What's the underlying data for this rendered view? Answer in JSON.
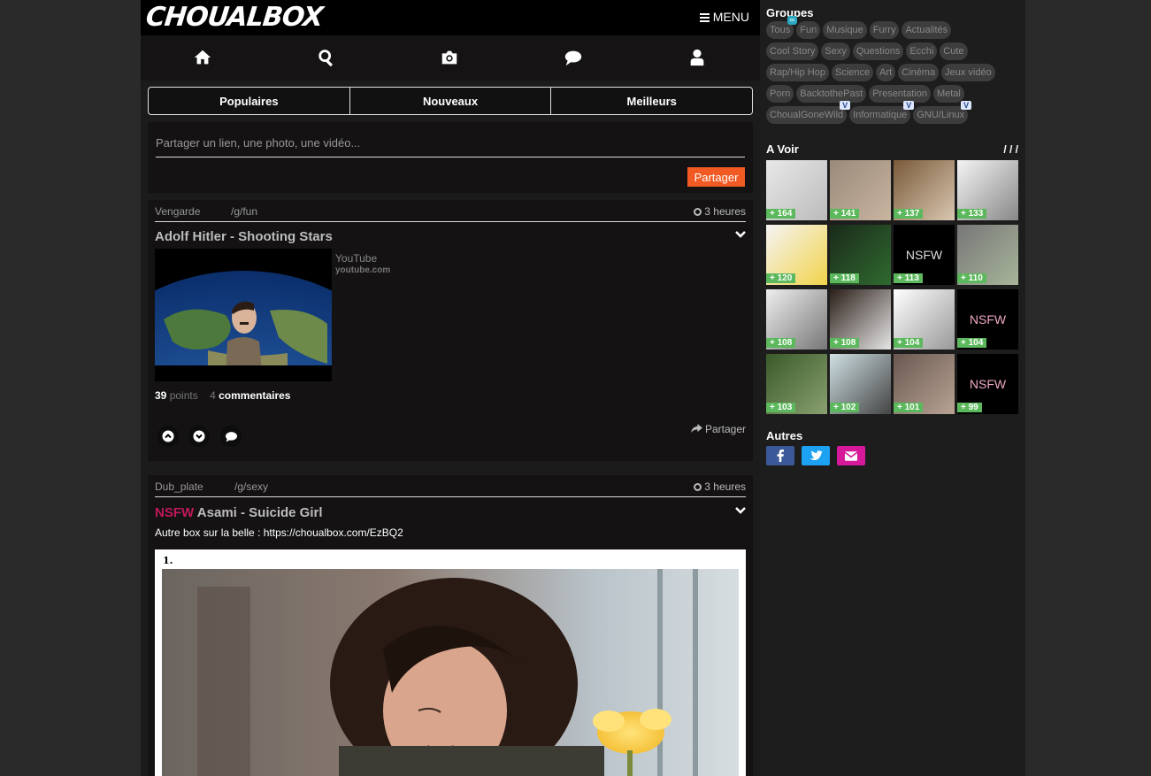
{
  "header": {
    "logo": "CHOUALBOX",
    "menu_label": "MENU"
  },
  "nav_icons": [
    "home-icon",
    "search-icon",
    "camera-icon",
    "comment-icon",
    "user-icon"
  ],
  "tabs": [
    "Populaires",
    "Nouveaux",
    "Meilleurs"
  ],
  "share": {
    "placeholder": "Partager un lien, une photo, une vidéo...",
    "button": "Partager"
  },
  "posts": [
    {
      "user": "Vengarde",
      "group": "/g/fun",
      "time": "3 heures",
      "title": "Adolf Hitler - Shooting Stars",
      "source": "YouTube",
      "domain": "youtube.com",
      "points": "39",
      "points_label": "points",
      "comments": "4",
      "comments_label": "commentaires",
      "share_label": "Partager"
    },
    {
      "user": "Dub_plate",
      "group": "/g/sexy",
      "time": "3 heures",
      "tag": "NSFW",
      "title": "Asami - Suicide Girl",
      "description": "Autre box sur la belle : https://choualbox.com/EzBQ2",
      "list_number": "1."
    }
  ],
  "sidebar": {
    "groups_title": "Groupes",
    "groups": [
      {
        "label": "Tous",
        "badge": "∞"
      },
      {
        "label": "Fun"
      },
      {
        "label": "Musique"
      },
      {
        "label": "Furry"
      },
      {
        "label": "Actualités"
      },
      {
        "label": "Cool Story"
      },
      {
        "label": "Sexy"
      },
      {
        "label": "Questions"
      },
      {
        "label": "Ecchi"
      },
      {
        "label": "Cute"
      },
      {
        "label": "Rap/Hip Hop"
      },
      {
        "label": "Science"
      },
      {
        "label": "Art"
      },
      {
        "label": "Cinéma"
      },
      {
        "label": "Jeux vidéo"
      },
      {
        "label": "Porn"
      },
      {
        "label": "BacktothePast"
      },
      {
        "label": "Presentation"
      },
      {
        "label": "Metal"
      },
      {
        "label": "ChoualGoneWild",
        "v": "V"
      },
      {
        "label": "Informatique",
        "v": "V"
      },
      {
        "label": "GNU/Linux",
        "v": "V"
      }
    ],
    "avoir_title": "A Voir",
    "avoir_nav": "/ / /",
    "avoir_scores": [
      "+ 164",
      "+ 141",
      "+ 137",
      "+ 133",
      "+ 120",
      "+ 118",
      "+ 113",
      "+ 110",
      "+ 108",
      "+ 108",
      "+ 104",
      "+ 104",
      "+ 103",
      "+ 102",
      "+ 101",
      "+ 99"
    ],
    "nsfw_label": "NSFW",
    "autres_title": "Autres"
  },
  "colors": {
    "accent": "#f15a23",
    "score": "#5cb85c",
    "nsfw": "#c2185b",
    "facebook": "#3b5998",
    "twitter": "#1da1f2",
    "email": "#d6199a"
  }
}
